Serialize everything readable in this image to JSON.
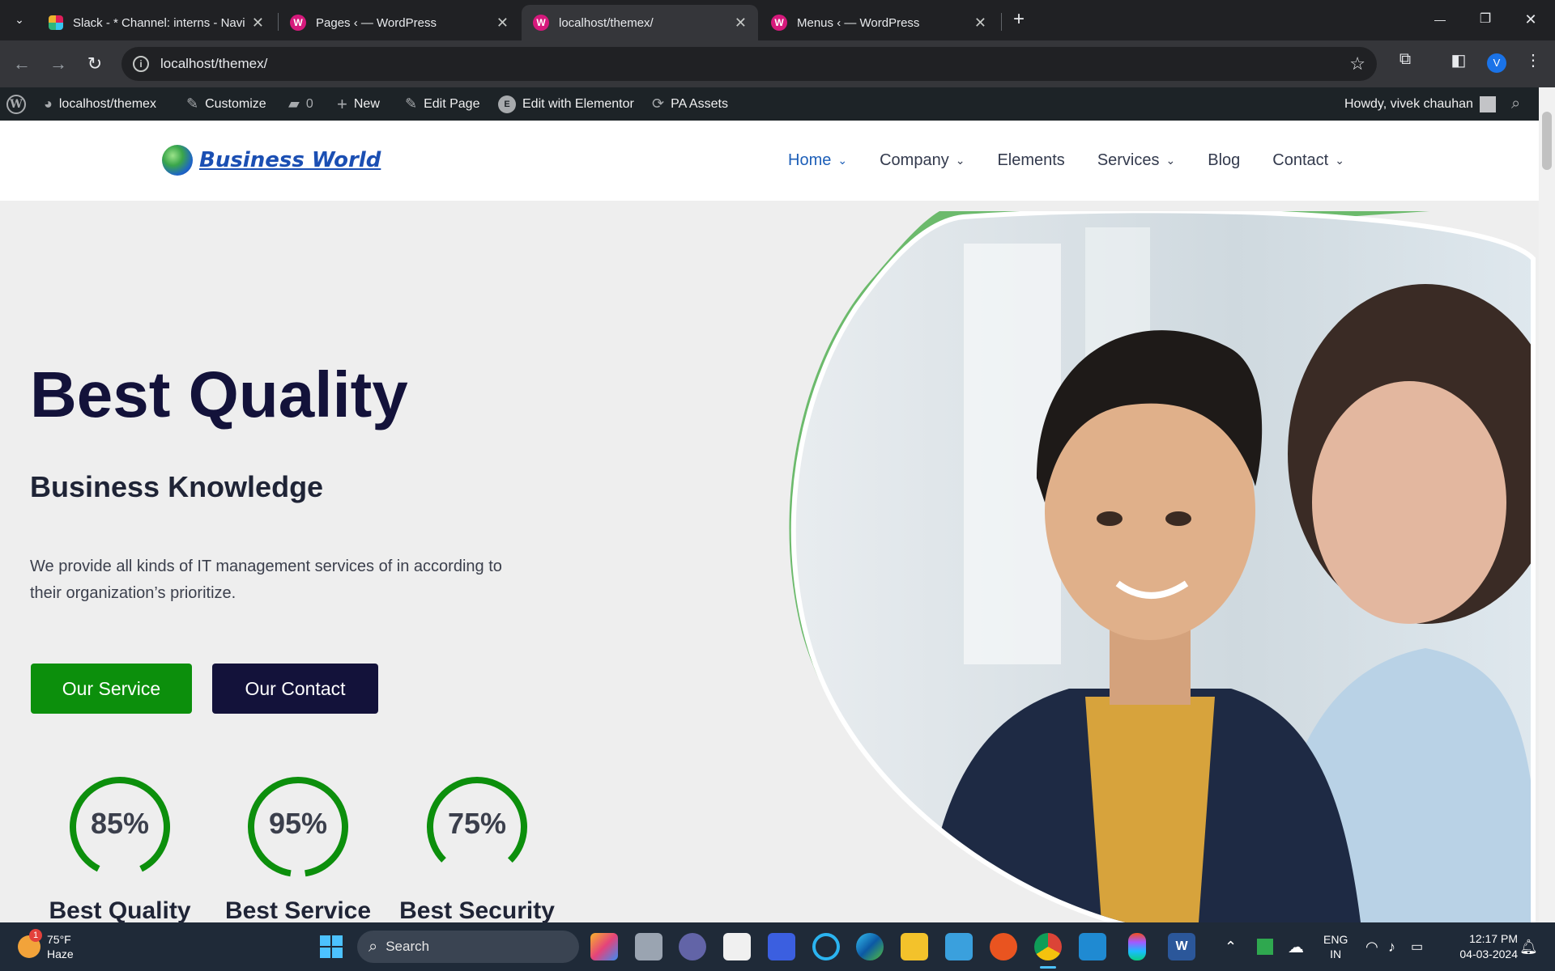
{
  "browser": {
    "tabs": [
      {
        "title": "Slack - * Channel: interns - Navi",
        "icon": "slack-icon",
        "active": false
      },
      {
        "title": "Pages ‹ — WordPress",
        "icon": "wordpress-icon",
        "active": false
      },
      {
        "title": "localhost/themex/",
        "icon": "wordpress-icon",
        "active": true
      },
      {
        "title": "Menus ‹ — WordPress",
        "icon": "wordpress-icon",
        "active": false
      }
    ],
    "url": "localhost/themex/",
    "profile_initial": "V",
    "new_tab_symbol": "+",
    "close_symbol": "✕",
    "minimize_symbol": "—",
    "restore_symbol": "❐"
  },
  "wp_admin_bar": {
    "site": "localhost/themex",
    "customize": "Customize",
    "comments_count": "0",
    "new": "New",
    "edit_page": "Edit Page",
    "edit_elementor": "Edit with Elementor",
    "pa_assets": "PA Assets",
    "howdy": "Howdy, vivek chauhan"
  },
  "site": {
    "brand": "Business World",
    "nav": [
      {
        "label": "Home",
        "has_dropdown": true,
        "active": true
      },
      {
        "label": "Company",
        "has_dropdown": true,
        "active": false
      },
      {
        "label": "Elements",
        "has_dropdown": false,
        "active": false
      },
      {
        "label": "Services",
        "has_dropdown": true,
        "active": false
      },
      {
        "label": "Blog",
        "has_dropdown": false,
        "active": false
      },
      {
        "label": "Contact",
        "has_dropdown": true,
        "active": false
      }
    ],
    "hero": {
      "title": "Best Quality",
      "subtitle": "Business Knowledge",
      "description": "We provide all kinds of IT management services of in according to their organization’s prioritize.",
      "primary_button": "Our Service",
      "secondary_button": "Our Contact"
    },
    "stats": [
      {
        "value": "85%",
        "fraction": 0.85,
        "label": "Best Quality"
      },
      {
        "value": "95%",
        "fraction": 0.95,
        "label": "Best Service"
      },
      {
        "value": "75%",
        "fraction": 0.75,
        "label": "Best Security"
      }
    ],
    "colors": {
      "brand_blue": "#1b4fb3",
      "heading_navy": "#13123a",
      "accent_green": "#0c8f0c",
      "hero_background": "#eeeeee"
    }
  },
  "taskbar": {
    "weather_temp": "75°F",
    "weather_desc": "Haze",
    "weather_badge": "1",
    "search_placeholder": "Search",
    "lang_line1": "ENG",
    "lang_line2": "IN",
    "time": "12:17 PM",
    "date": "04-03-2024"
  }
}
